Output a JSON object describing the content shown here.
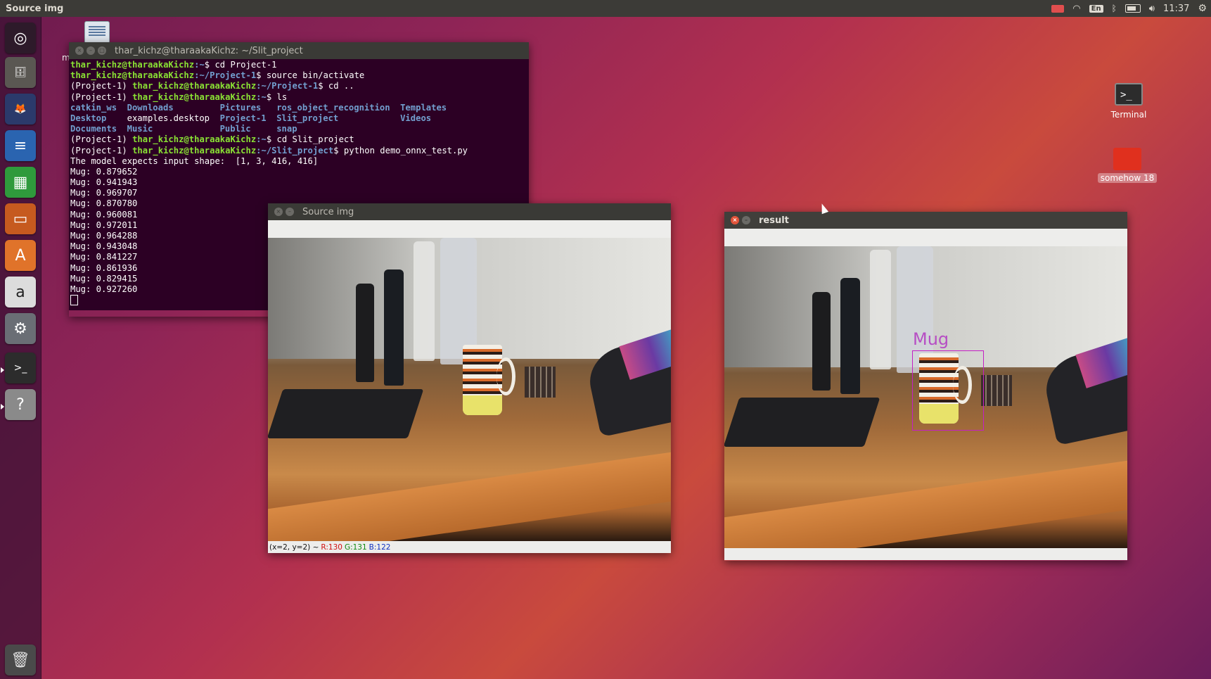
{
  "topbar": {
    "app_title": "Source img",
    "keyboard_layout": "En",
    "clock": "11:37"
  },
  "launcher": {
    "items": [
      {
        "name": "ubuntu-dash-icon",
        "glyph": "◎",
        "bg": "#2d1a2a"
      },
      {
        "name": "files-icon",
        "glyph": "🗄",
        "bg": "#5a5752"
      },
      {
        "name": "firefox-icon",
        "glyph": "🦊",
        "bg": "#2b3a6b"
      },
      {
        "name": "writer-icon",
        "glyph": "≡",
        "bg": "#2a64b0"
      },
      {
        "name": "calc-icon",
        "glyph": "▦",
        "bg": "#2f9a3c"
      },
      {
        "name": "impress-icon",
        "glyph": "▭",
        "bg": "#c65a1f"
      },
      {
        "name": "software-center-icon",
        "glyph": "A",
        "bg": "#e0732a"
      },
      {
        "name": "amazon-icon",
        "glyph": "a",
        "bg": "#dcdcdc"
      },
      {
        "name": "settings-icon",
        "glyph": "⚙",
        "bg": "#6a6e75"
      },
      {
        "name": "terminal-icon",
        "glyph": ">_",
        "bg": "#2c2c2c"
      },
      {
        "name": "help-icon",
        "glyph": "?",
        "bg": "#8a8a8a"
      }
    ],
    "trash_glyph": "🗑"
  },
  "desktop": {
    "terminal_label": "Terminal",
    "folder_label": "somehow 18",
    "partial_label": "m"
  },
  "terminal": {
    "title": "thar_kichz@tharaakaKichz: ~/Slit_project",
    "lines": [
      {
        "venv": "",
        "prompt": "thar_kichz@tharaakaKichz",
        "path": ":~",
        "cmd": "$ cd Project-1"
      },
      {
        "venv": "",
        "prompt": "thar_kichz@tharaakaKichz",
        "path": ":~/Project-1",
        "cmd": "$ source bin/activate"
      },
      {
        "venv": "(Project-1) ",
        "prompt": "thar_kichz@tharaakaKichz",
        "path": ":~/Project-1",
        "cmd": "$ cd .."
      },
      {
        "venv": "(Project-1) ",
        "prompt": "thar_kichz@tharaakaKichz",
        "path": ":~",
        "cmd": "$ ls"
      }
    ],
    "ls_columns": [
      [
        "catkin_ws",
        "Downloads",
        "Pictures",
        "ros_object_recognition",
        "Templates"
      ],
      [
        "Desktop",
        "examples.desktop",
        "Project-1",
        "Slit_project",
        "Videos"
      ],
      [
        "Documents",
        "Music",
        "Public",
        "snap",
        ""
      ]
    ],
    "ls_plain": [
      "examples.desktop"
    ],
    "lines2": [
      {
        "venv": "(Project-1) ",
        "prompt": "thar_kichz@tharaakaKichz",
        "path": ":~",
        "cmd": "$ cd Slit_project"
      },
      {
        "venv": "(Project-1) ",
        "prompt": "thar_kichz@tharaakaKichz",
        "path": ":~/Slit_project",
        "cmd": "$ python demo_onnx_test.py"
      }
    ],
    "model_line": "The model expects input shape:  [1, 3, 416, 416]",
    "detections": [
      "Mug: 0.879652",
      "Mug: 0.941943",
      "Mug: 0.969707",
      "Mug: 0.870780",
      "Mug: 0.960081",
      "Mug: 0.972011",
      "Mug: 0.964288",
      "Mug: 0.943048",
      "Mug: 0.841227",
      "Mug: 0.861936",
      "Mug: 0.829415",
      "Mug: 0.927260"
    ]
  },
  "source_window": {
    "title": "Source img",
    "status_coords": "(x=2, y=2) ~",
    "status_r": "R:130",
    "status_g": "G:131",
    "status_b": "B:122",
    "colors": {
      "r": "#d01010",
      "g": "#108a10",
      "b": "#1030c0"
    }
  },
  "result_window": {
    "title": "result",
    "detection_label": "Mug"
  }
}
